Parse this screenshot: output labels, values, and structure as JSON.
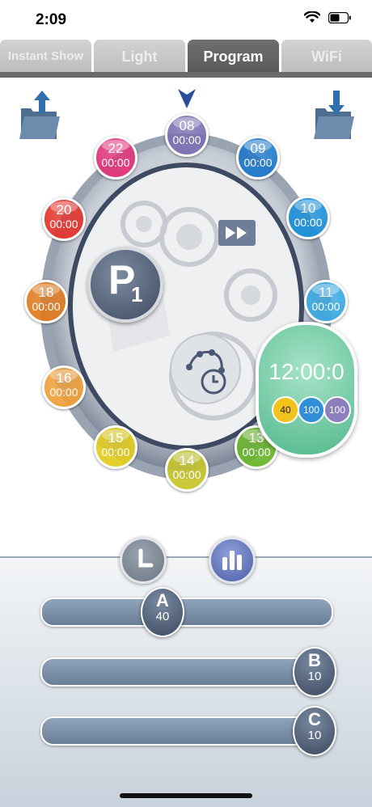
{
  "status_bar": {
    "time": "2:09"
  },
  "tabs": [
    {
      "label": "Instant Show",
      "active": false
    },
    {
      "label": "Light",
      "active": false
    },
    {
      "label": "Program",
      "active": true
    },
    {
      "label": "WiFi",
      "active": false
    }
  ],
  "dial": {
    "program": {
      "letter": "P",
      "number": "1"
    },
    "slots": [
      {
        "hour": "08",
        "time": "00:00",
        "color": "#7c6fb0"
      },
      {
        "hour": "09",
        "time": "00:00",
        "color": "#1f78c9"
      },
      {
        "hour": "10",
        "time": "00:00",
        "color": "#1a8fd8"
      },
      {
        "hour": "11",
        "time": "00:00",
        "color": "#3aa8e0"
      },
      {
        "hour": "13",
        "time": "00:00",
        "color": "#6ab52a"
      },
      {
        "hour": "14",
        "time": "00:00",
        "color": "#c8c62a"
      },
      {
        "hour": "15",
        "time": "00:00",
        "color": "#e2cc1e"
      },
      {
        "hour": "16",
        "time": "00:00",
        "color": "#f09f3a"
      },
      {
        "hour": "18",
        "time": "00:00",
        "color": "#e07a1f"
      },
      {
        "hour": "20",
        "time": "00:00",
        "color": "#e2332d"
      },
      {
        "hour": "22",
        "time": "00:00",
        "color": "#e0337a"
      }
    ],
    "current": {
      "time": "12:00:0",
      "values": [
        {
          "value": "40",
          "color": "#f2c31a",
          "text_color": "#222"
        },
        {
          "value": "100",
          "color": "#2f8fd8",
          "text_color": "#fff"
        },
        {
          "value": "100",
          "color": "#8d7fbe",
          "text_color": "#fff"
        }
      ]
    }
  },
  "sliders": [
    {
      "label": "A",
      "value": "40",
      "level": 0.42
    },
    {
      "label": "B",
      "value": "10",
      "level": 1.0
    },
    {
      "label": "C",
      "value": "10",
      "level": 1.0
    }
  ]
}
